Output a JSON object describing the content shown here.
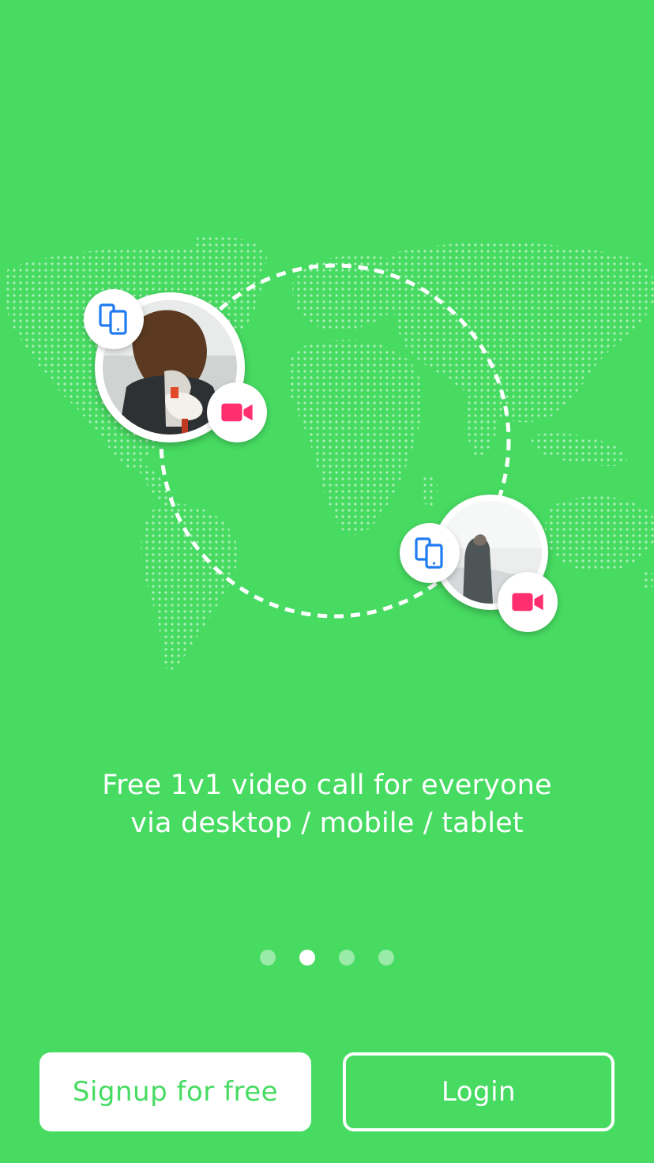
{
  "tagline": {
    "line1": "Free 1v1 video call for everyone",
    "line2": "via desktop / mobile / tablet"
  },
  "pager": {
    "count": 4,
    "active_index": 1
  },
  "buttons": {
    "signup_label": "Signup for free",
    "login_label": "Login"
  },
  "icons": {
    "device": "devices-icon",
    "video": "video-camera-icon",
    "map": "world-map-dots"
  },
  "colors": {
    "background": "#47DB62",
    "device_icon": "#1E7BF2",
    "video_icon": "#FF2E6E",
    "white": "#FFFFFF"
  }
}
